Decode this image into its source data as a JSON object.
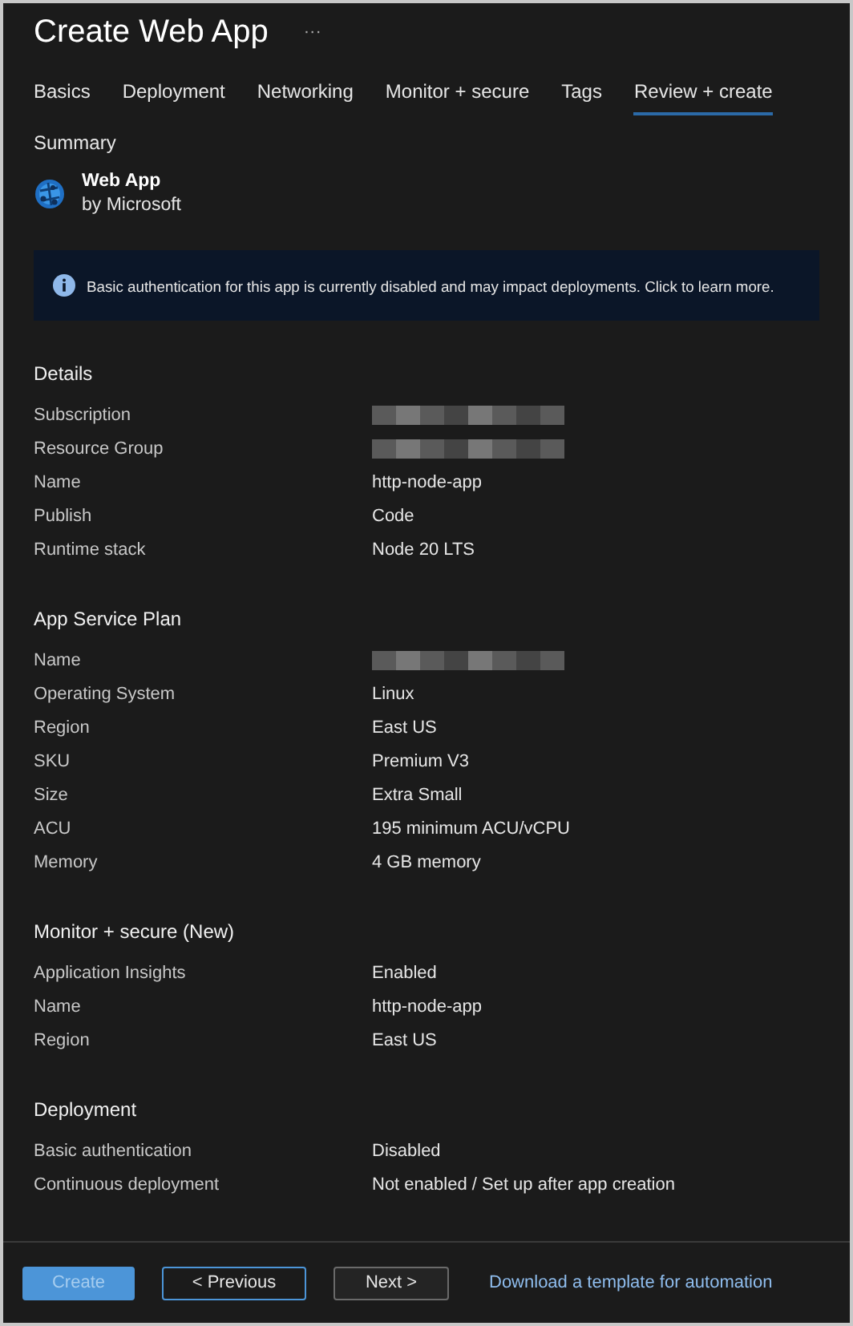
{
  "window": {
    "title": "Create Web App",
    "more": "···"
  },
  "tabs": [
    {
      "label": "Basics",
      "selected": false
    },
    {
      "label": "Deployment",
      "selected": false
    },
    {
      "label": "Networking",
      "selected": false
    },
    {
      "label": "Monitor + secure",
      "selected": false
    },
    {
      "label": "Tags",
      "selected": false
    },
    {
      "label": "Review + create",
      "selected": true
    }
  ],
  "summary": {
    "heading": "Summary",
    "product": "Web App",
    "publisher": "by Microsoft"
  },
  "banner": {
    "text": "Basic authentication for this app is currently disabled and may impact deployments. Click to learn more."
  },
  "sections": [
    {
      "title": "Details",
      "rows": [
        {
          "label": "Subscription",
          "kind": "redacted"
        },
        {
          "label": "Resource Group",
          "kind": "redacted"
        },
        {
          "label": "Name",
          "kind": "text",
          "value": "http-node-app"
        },
        {
          "label": "Publish",
          "kind": "text",
          "value": "Code"
        },
        {
          "label": "Runtime stack",
          "kind": "text",
          "value": "Node 20 LTS"
        }
      ]
    },
    {
      "title": "App Service Plan",
      "rows": [
        {
          "label": "Name",
          "kind": "redacted"
        },
        {
          "label": "Operating System",
          "kind": "text",
          "value": "Linux"
        },
        {
          "label": "Region",
          "kind": "text",
          "value": "East US"
        },
        {
          "label": "SKU",
          "kind": "text",
          "value": "Premium V3"
        },
        {
          "label": "Size",
          "kind": "text",
          "value": "Extra Small"
        },
        {
          "label": "ACU",
          "kind": "text",
          "value": "195 minimum ACU/vCPU"
        },
        {
          "label": "Memory",
          "kind": "text",
          "value": "4 GB memory"
        }
      ]
    },
    {
      "title": "Monitor + secure (New)",
      "rows": [
        {
          "label": "Application Insights",
          "kind": "text",
          "value": "Enabled"
        },
        {
          "label": "Name",
          "kind": "text",
          "value": "http-node-app"
        },
        {
          "label": "Region",
          "kind": "text",
          "value": "East US"
        }
      ]
    },
    {
      "title": "Deployment",
      "rows": [
        {
          "label": "Basic authentication",
          "kind": "text",
          "value": "Disabled"
        },
        {
          "label": "Continuous deployment",
          "kind": "text",
          "value": "Not enabled / Set up after app creation"
        }
      ]
    }
  ],
  "footer": {
    "buttons": [
      {
        "label": "Create",
        "kind": "primary",
        "disabled": true,
        "focused": false
      },
      {
        "label": "< Previous",
        "kind": "secondary",
        "disabled": false,
        "focused": true
      },
      {
        "label": "Next >",
        "kind": "secondary",
        "disabled": false,
        "focused": false
      }
    ],
    "link": "Download a template for automation"
  }
}
